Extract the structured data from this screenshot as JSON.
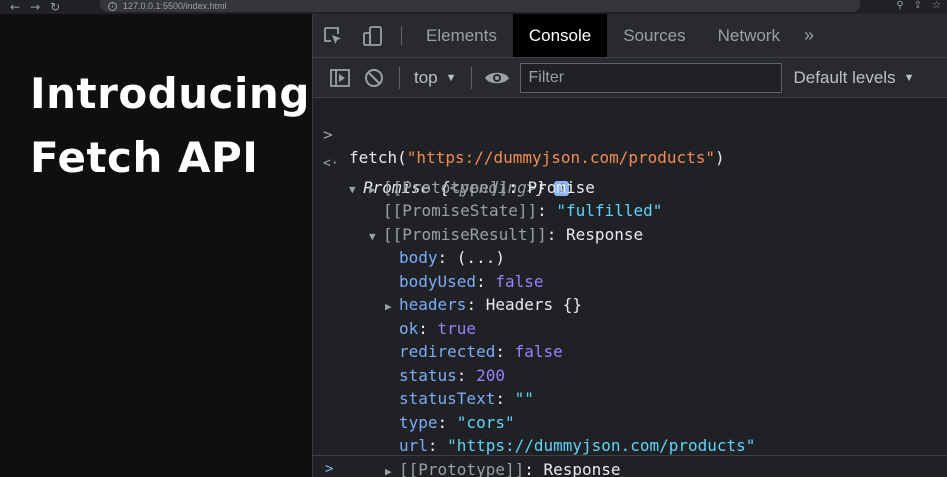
{
  "browser": {
    "url": "127.0.0.1:5500/index.html",
    "nav_back": "←",
    "nav_forward": "→",
    "reload": "↻",
    "info_glyph": "i",
    "zoom": "⚲",
    "share": "⇪",
    "star": "☆"
  },
  "slide": {
    "line1": "Introducing",
    "line2": "Fetch API"
  },
  "devtools": {
    "tabs": [
      "Elements",
      "Console",
      "Sources",
      "Network"
    ],
    "more_tabs": "»",
    "context": "top",
    "filter_placeholder": "Filter",
    "levels": "Default levels",
    "dropdown_arrow": "▼"
  },
  "console": {
    "input_prompt": ">",
    "result_prompt": "<·",
    "expanded_tri": "▼",
    "collapsed_tri": "▶",
    "command_fn": "fetch(",
    "command_url": "\"https://dummyjson.com/products\"",
    "command_close": ")",
    "promise_label": "Promise",
    "promise_state_open": "{",
    "promise_state": "<pending>",
    "promise_state_close": "}",
    "info_badge": "i",
    "proto_key": "[[Prototype]]",
    "proto_value": "Promise",
    "state_key": "[[PromiseState]]",
    "state_value": "\"fulfilled\"",
    "result_key": "[[PromiseResult]]",
    "result_value": "Response",
    "sep": ": ",
    "fields": {
      "body_key": "body",
      "body_value": "(...)",
      "bodyUsed_key": "bodyUsed",
      "bodyUsed_value": "false",
      "headers_key": "headers",
      "headers_value": "Headers {}",
      "ok_key": "ok",
      "ok_value": "true",
      "redirected_key": "redirected",
      "redirected_value": "false",
      "status_key": "status",
      "status_value": "200",
      "statusText_key": "statusText",
      "statusText_value": "\"\"",
      "type_key": "type",
      "type_value": "\"cors\"",
      "url_key": "url",
      "url_value": "\"https://dummyjson.com/products\""
    },
    "response_proto_key": "[[Prototype]]",
    "response_proto_value": "Response",
    "bottom_prompt": ">"
  }
}
